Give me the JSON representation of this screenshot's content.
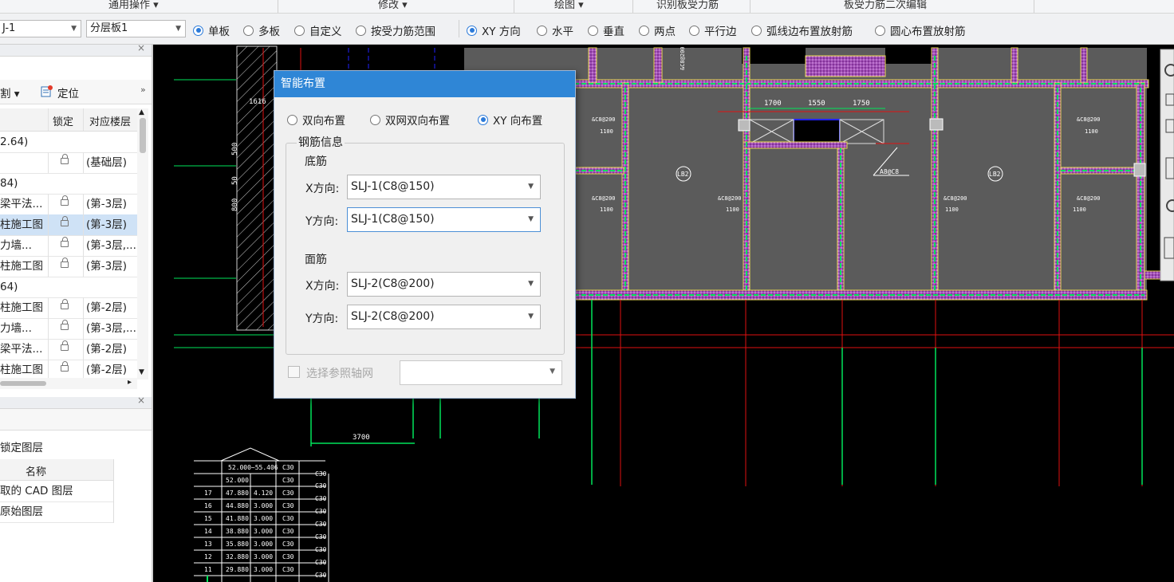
{
  "ribbon": {
    "groups": [
      "通用操作 ▾",
      "修改 ▾",
      "绘图 ▾",
      "识别板受力筋",
      "板受力筋二次编辑"
    ]
  },
  "optbar": {
    "combo1": "J-1",
    "combo2": "分层板1",
    "radios_a": [
      {
        "label": "单板",
        "checked": true
      },
      {
        "label": "多板",
        "checked": false
      },
      {
        "label": "自定义",
        "checked": false
      },
      {
        "label": "按受力筋范围",
        "checked": false
      }
    ],
    "radios_b": [
      {
        "label": "XY 方向",
        "checked": true
      },
      {
        "label": "水平",
        "checked": false
      },
      {
        "label": "垂直",
        "checked": false
      },
      {
        "label": "两点",
        "checked": false
      },
      {
        "label": "平行边",
        "checked": false
      },
      {
        "label": "弧线边布置放射筋",
        "checked": false
      },
      {
        "label": "圆心布置放射筋",
        "checked": false
      }
    ]
  },
  "panel1": {
    "toolbar": {
      "split": "割",
      "locate": "定位"
    },
    "columns": {
      "lock": "锁定",
      "floor": "对应楼层"
    },
    "rows": [
      {
        "name": "2.64)",
        "floor": "",
        "lock": false,
        "group": true
      },
      {
        "name": "",
        "floor": "(基础层)",
        "lock": true
      },
      {
        "name": "84)",
        "floor": "",
        "lock": false,
        "group": true
      },
      {
        "name": "梁平法...",
        "floor": "(第-3层)",
        "lock": true
      },
      {
        "name": "柱施工图",
        "floor": "(第-3层)",
        "lock": true,
        "selected": true
      },
      {
        "name": "力墙...",
        "floor": "(第-3层,...",
        "lock": true
      },
      {
        "name": "柱施工图",
        "floor": "(第-3层)",
        "lock": true
      },
      {
        "name": "64)",
        "floor": "",
        "lock": false,
        "group": true
      },
      {
        "name": "柱施工图",
        "floor": "(第-2层)",
        "lock": true
      },
      {
        "name": "力墙...",
        "floor": "(第-3层,...",
        "lock": true
      },
      {
        "name": "梁平法...",
        "floor": "(第-2层)",
        "lock": true
      },
      {
        "name": "柱施工图",
        "floor": "(第-2层)",
        "lock": true
      }
    ]
  },
  "panel2": {
    "filter_label": "锁定图层",
    "column": "名称",
    "rows": [
      "取的 CAD 图层",
      "原始图层"
    ]
  },
  "dialog": {
    "title": "智能布置",
    "modes": [
      {
        "label": "双向布置",
        "checked": false
      },
      {
        "label": "双网双向布置",
        "checked": false
      },
      {
        "label": "XY 向布置",
        "checked": true
      }
    ],
    "group_label": "钢筋信息",
    "bottom_label": "底筋",
    "top_label": "面筋",
    "x_label": "X方向:",
    "y_label": "Y方向:",
    "bottom_x": "SLJ-1(C8@150)",
    "bottom_y": "SLJ-1(C8@150)",
    "top_x": "SLJ-2(C8@200)",
    "top_y": "SLJ-2(C8@200)",
    "grid_label": "选择参照轴网",
    "grid_value": ""
  },
  "cad": {
    "dims": [
      "1700",
      "1550",
      "1750",
      "3700"
    ],
    "slab_labels": [
      "LB2",
      "LB2"
    ],
    "rebar_labels": [
      "&C8@200",
      "&C8@200",
      "&C8@200",
      "&C8@200",
      "&C8@200",
      "&C8@200",
      "&C8@200"
    ],
    "rebar_lens": [
      "1100",
      "1100",
      "1100",
      "1100",
      "1100",
      "1100"
    ],
    "small_label": "A8@C8",
    "table": {
      "header": [
        "",
        "52.000~55.406",
        "C30"
      ],
      "rows": [
        [
          "",
          "52.000",
          "",
          "C30"
        ],
        [
          "17",
          "47.880",
          "4.120",
          "C30"
        ],
        [
          "16",
          "44.880",
          "3.000",
          "C30"
        ],
        [
          "15",
          "41.880",
          "3.000",
          "C30"
        ],
        [
          "14",
          "38.880",
          "3.000",
          "C30"
        ],
        [
          "13",
          "35.880",
          "3.000",
          "C30"
        ],
        [
          "12",
          "32.880",
          "3.000",
          "C30"
        ],
        [
          "11",
          "29.880",
          "3.000",
          "C30"
        ]
      ],
      "side": [
        "C30",
        "C30",
        "C30",
        "C30",
        "C30",
        "C30",
        "C30",
        "C30",
        "C30"
      ]
    },
    "left_dims": [
      "500",
      "50",
      "800"
    ],
    "left_text": "1616"
  },
  "colors": {
    "accent": "#2f86d6",
    "cad_bg": "#000000",
    "slab": "#5a5a5a",
    "wall_green": "#00e45a",
    "wall_yellow": "#e8d850",
    "wall_purple": "#8a2aa3",
    "red_line": "#e01010",
    "blue_line": "#2020ff"
  }
}
